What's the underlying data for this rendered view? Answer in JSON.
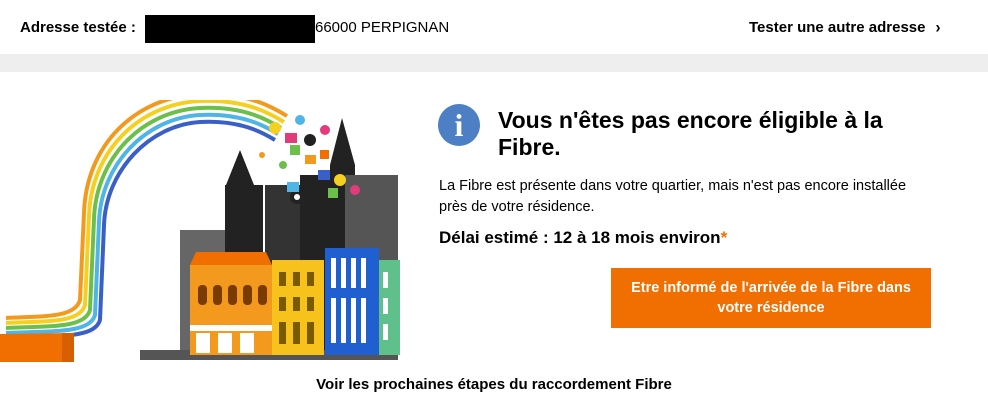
{
  "header": {
    "address_label": "Adresse testée :",
    "address_city": "66000 PERPIGNAN",
    "other_address_link": "Tester une autre adresse",
    "other_address_chevron": "›"
  },
  "result": {
    "icon": "info-icon",
    "icon_glyph": "i",
    "title": "Vous n'êtes pas encore éligible à la Fibre.",
    "description": "La Fibre est présente dans votre quartier, mais n'est pas encore installée près de votre résidence.",
    "delay_text": "Délai estimé : 12 à 18 mois environ",
    "delay_asterisk": "*",
    "cta_label": "Etre informé de l'arrivée de la Fibre dans votre résidence"
  },
  "footer": {
    "next_steps_link": "Voir les prochaines étapes du raccordement Fibre"
  },
  "colors": {
    "accent_orange": "#f16e00",
    "info_blue": "#4c7fc3",
    "band_grey": "#eeeeee"
  }
}
